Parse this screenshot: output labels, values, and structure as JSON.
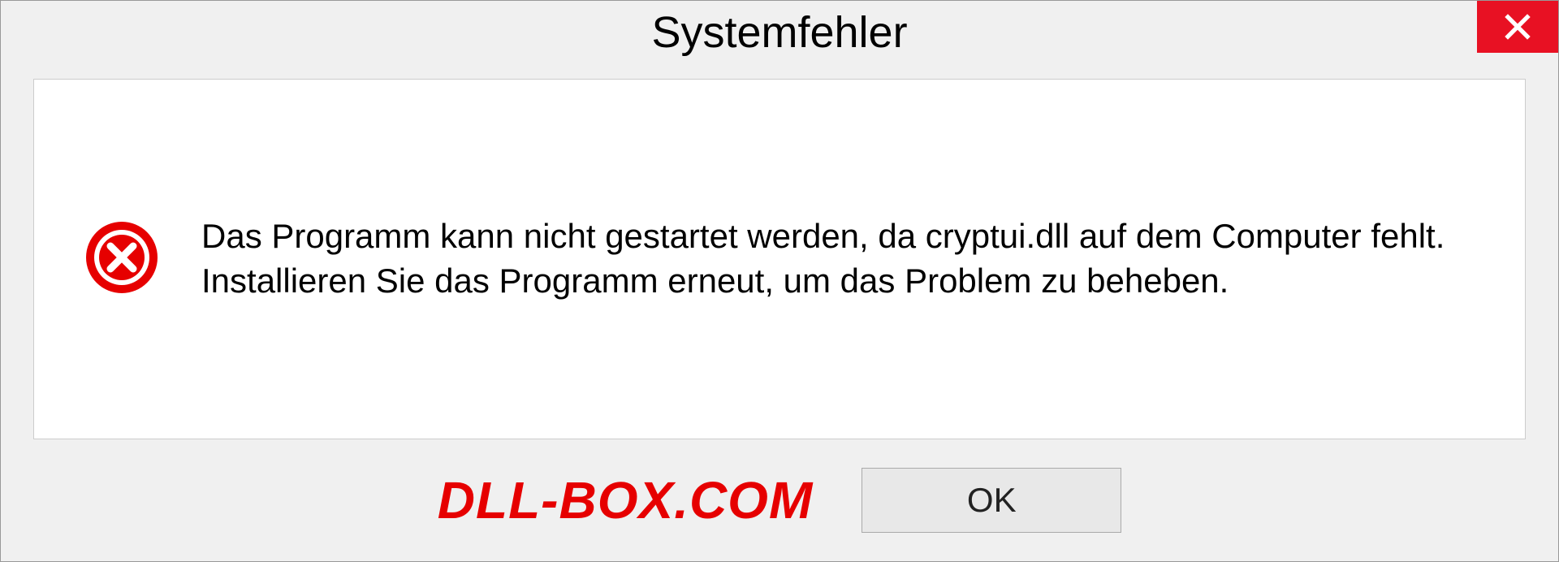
{
  "dialog": {
    "title": "Systemfehler",
    "message": "Das Programm kann nicht gestartet werden, da cryptui.dll auf dem Computer fehlt. Installieren Sie das Programm erneut, um das Problem zu beheben.",
    "ok_label": "OK"
  },
  "watermark": "DLL-BOX.COM"
}
